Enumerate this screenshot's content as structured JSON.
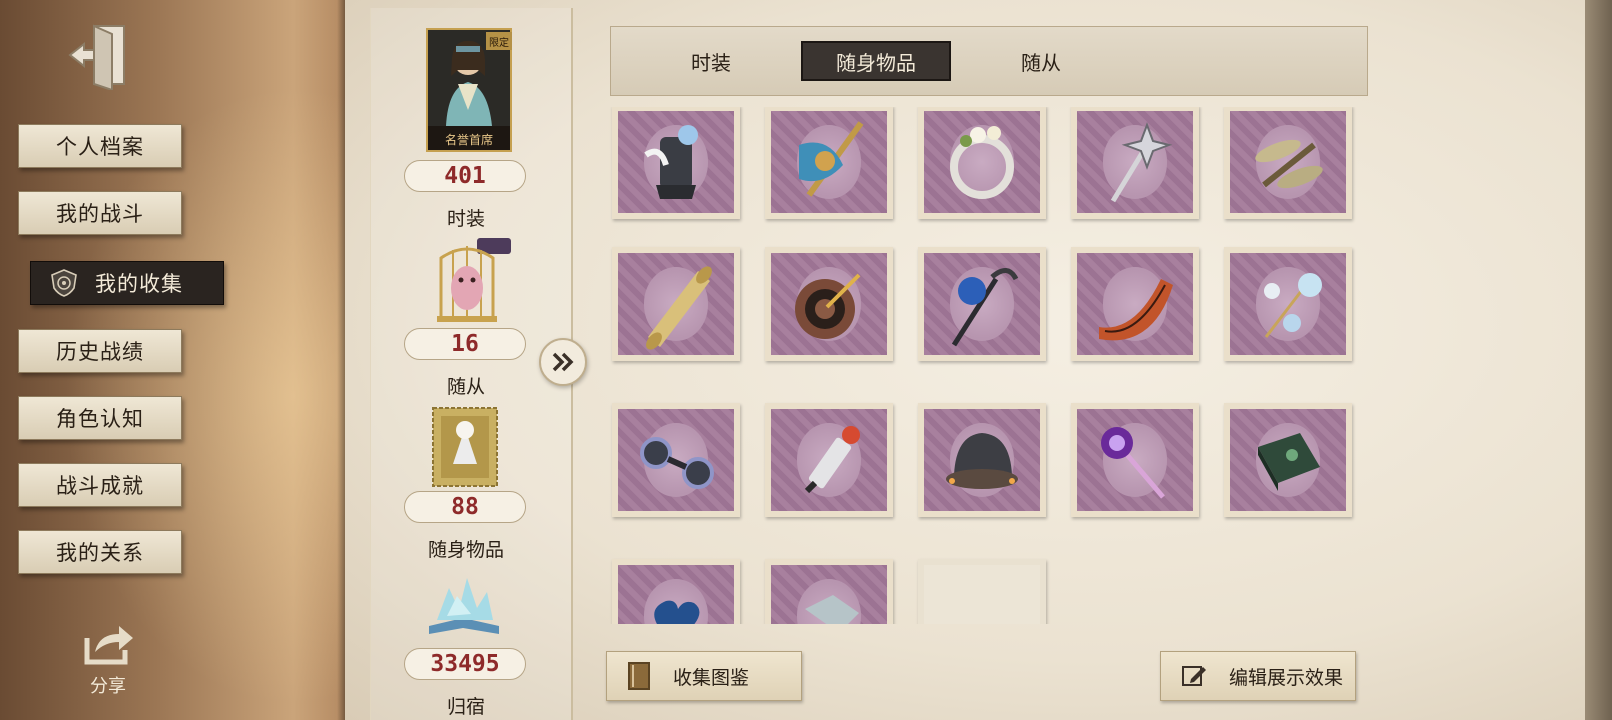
{
  "sidebar": {
    "exit_icon": "exit-door-icon",
    "items": [
      {
        "label": "个人档案",
        "active": false
      },
      {
        "label": "我的战斗",
        "active": false
      },
      {
        "label": "我的收集",
        "active": true,
        "icon": "shield-emblem-icon"
      },
      {
        "label": "历史战绩",
        "active": false
      },
      {
        "label": "角色认知",
        "active": false
      },
      {
        "label": "战斗成就",
        "active": false
      },
      {
        "label": "我的关系",
        "active": false
      }
    ],
    "share_label": "分享",
    "share_icon": "share-arrow-icon"
  },
  "stats": {
    "badge_tag": "限定",
    "portrait_caption": "名誉首席",
    "items": [
      {
        "count": "401",
        "label": "时装"
      },
      {
        "count": "16",
        "label": "随从"
      },
      {
        "count": "88",
        "label": "随身物品"
      },
      {
        "count": "33495",
        "label": "归宿"
      }
    ],
    "expand_icon": "double-chevron-right-icon"
  },
  "tabs": [
    {
      "label": "时装",
      "active": false
    },
    {
      "label": "随身物品",
      "active": true
    },
    {
      "label": "随从",
      "active": false
    }
  ],
  "grid": {
    "items": [
      {
        "icon": "lantern-rose-icon"
      },
      {
        "icon": "ornate-axe-icon"
      },
      {
        "icon": "flower-wreath-icon"
      },
      {
        "icon": "star-staff-icon"
      },
      {
        "icon": "dragonfly-icon"
      },
      {
        "icon": "scroll-icon"
      },
      {
        "icon": "target-dart-icon"
      },
      {
        "icon": "blue-rose-cane-icon"
      },
      {
        "icon": "boomerang-icon"
      },
      {
        "icon": "crystal-mobile-icon"
      },
      {
        "icon": "goggles-icon"
      },
      {
        "icon": "spark-plug-icon"
      },
      {
        "icon": "lantern-bell-icon"
      },
      {
        "icon": "mace-icon"
      },
      {
        "icon": "green-book-icon"
      },
      {
        "icon": "blue-heart-icon"
      },
      {
        "icon": "shard-icon"
      },
      {
        "icon": "empty-slot"
      }
    ]
  },
  "buttons": {
    "collection": {
      "label": "收集图鉴",
      "icon": "book-icon"
    },
    "edit": {
      "label": "编辑展示效果",
      "icon": "edit-pencil-icon"
    }
  },
  "colors": {
    "count_red": "#8e2a2a",
    "active_tab": "#3a3430",
    "stamp_purple": "#a8809e"
  }
}
